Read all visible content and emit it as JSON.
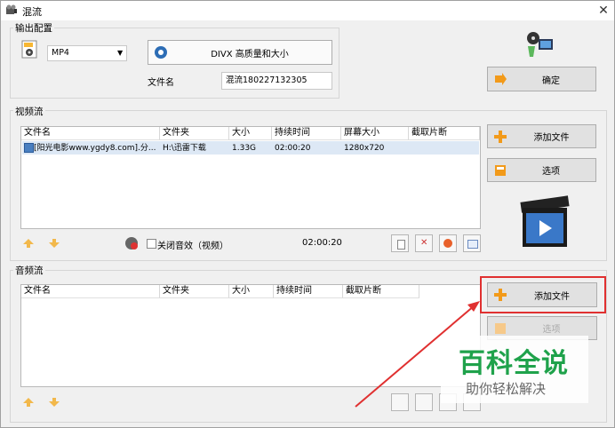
{
  "window": {
    "title": "混流",
    "close_glyph": "✕"
  },
  "output": {
    "label": "输出配置",
    "format": "MP4",
    "preset": "DIVX 高质量和大小",
    "filename_label": "文件名",
    "filename_value": "混流180227132305",
    "ok_button": "确定"
  },
  "video": {
    "label": "视频流",
    "headers": [
      "文件名",
      "文件夹",
      "大小",
      "持续时间",
      "屏幕大小",
      "截取片断"
    ],
    "rows": [
      {
        "name": "[阳光电影www.ygdy8.com].分...",
        "folder": "H:\\迅雷下载",
        "size": "1.33G",
        "duration": "02:00:20",
        "resolution": "1280x720"
      }
    ],
    "mute_label": "关闭音效（视频）",
    "total_duration": "02:00:20",
    "add_button": "添加文件",
    "options_button": "选项"
  },
  "audio": {
    "label": "音频流",
    "headers": [
      "文件名",
      "文件夹",
      "大小",
      "持续时间",
      "截取片断"
    ],
    "add_button": "添加文件",
    "options_button": "选项"
  },
  "watermark": {
    "title": "百科全说",
    "subtitle": "助你轻松解决"
  },
  "colors": {
    "accent": "#f29a1a",
    "highlight": "#e03030",
    "watermark_green": "#1fa24b"
  }
}
